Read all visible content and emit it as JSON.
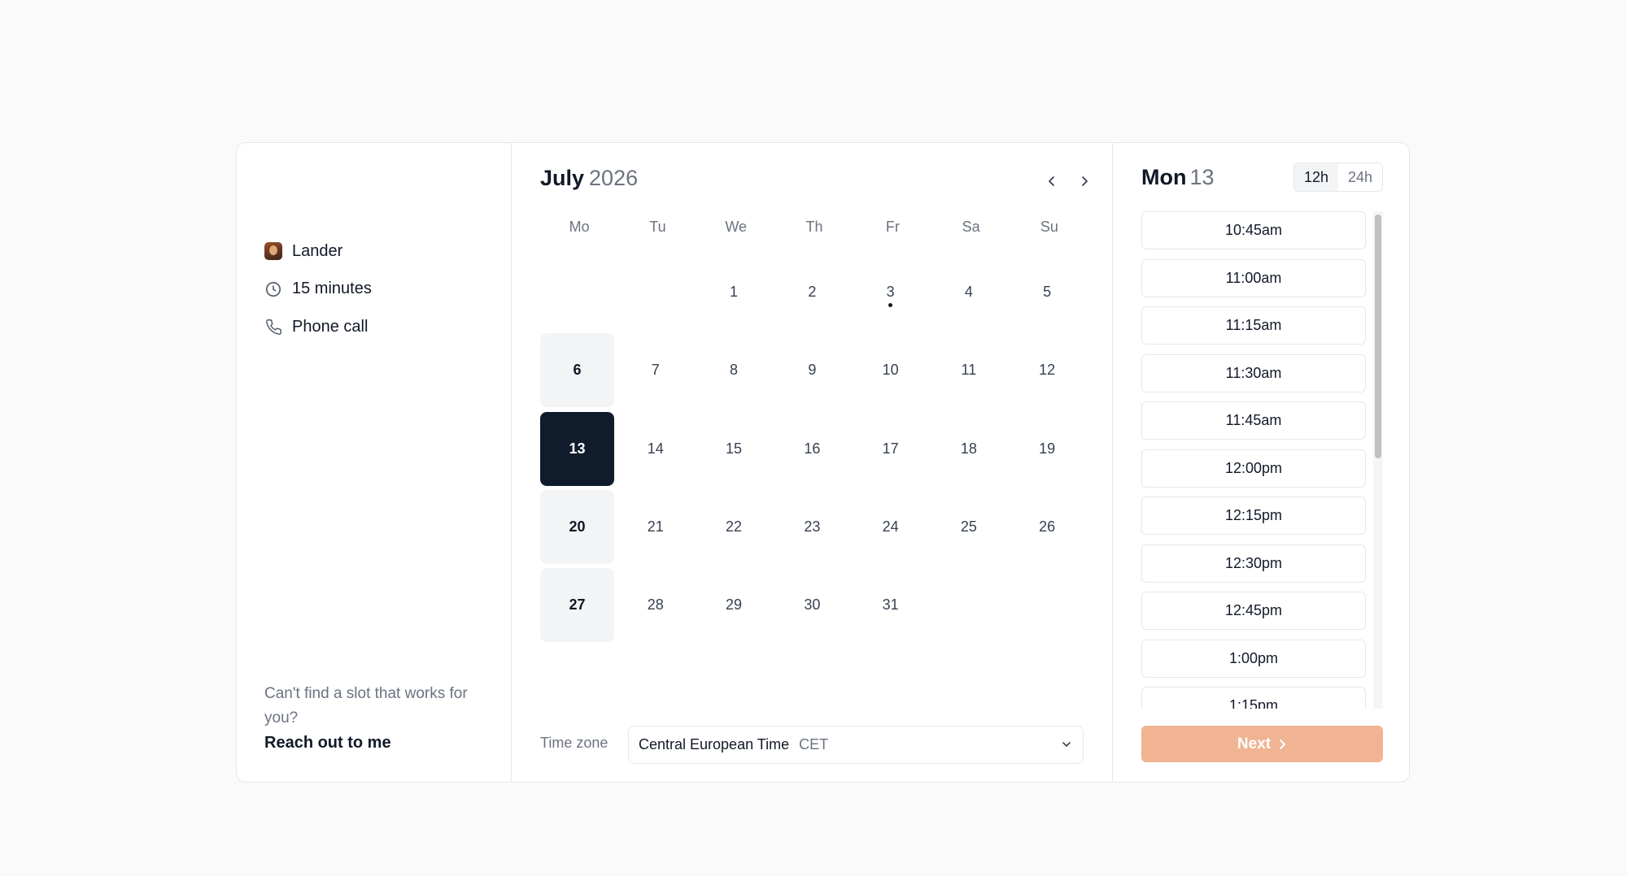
{
  "host": {
    "name": "Lander",
    "duration": "15 minutes",
    "location": "Phone call"
  },
  "help": {
    "question": "Can't find a slot that works for you?",
    "link": "Reach out to me"
  },
  "calendar": {
    "month": "July",
    "year": "2026",
    "weekdays": [
      "Mo",
      "Tu",
      "We",
      "Th",
      "Fr",
      "Sa",
      "Su"
    ],
    "weeks": [
      [
        "",
        "",
        "1",
        "2",
        "3",
        "4",
        "5"
      ],
      [
        "6",
        "7",
        "8",
        "9",
        "10",
        "11",
        "12"
      ],
      [
        "13",
        "14",
        "15",
        "16",
        "17",
        "18",
        "19"
      ],
      [
        "20",
        "21",
        "22",
        "23",
        "24",
        "25",
        "26"
      ],
      [
        "27",
        "28",
        "29",
        "30",
        "31",
        "",
        ""
      ]
    ],
    "selected_day": "13",
    "today": "3",
    "available_days": [
      "6",
      "13",
      "20",
      "27"
    ]
  },
  "timezone": {
    "label": "Time zone",
    "name": "Central European Time",
    "abbr": "CET"
  },
  "slots_panel": {
    "weekday": "Mon",
    "day": "13",
    "format_12h": "12h",
    "format_24h": "24h",
    "active_format": "12h",
    "slots": [
      "10:45am",
      "11:00am",
      "11:15am",
      "11:30am",
      "11:45am",
      "12:00pm",
      "12:15pm",
      "12:30pm",
      "12:45pm",
      "1:00pm",
      "1:15pm"
    ]
  },
  "next_button": {
    "label": "Next"
  },
  "colors": {
    "selected_day_bg": "#101b2b",
    "available_day_bg": "#f3f4f6",
    "next_button_bg": "#f0b493"
  }
}
